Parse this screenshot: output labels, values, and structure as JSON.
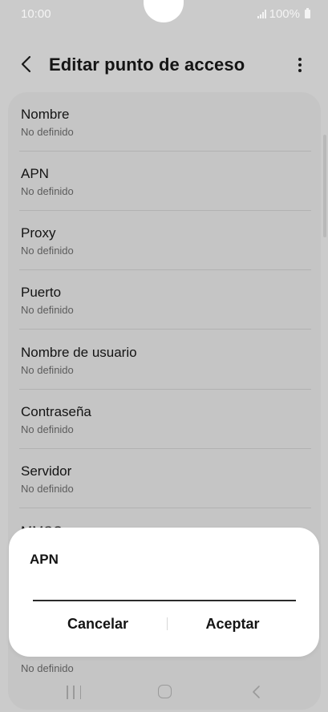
{
  "status_bar": {
    "time": "10:00",
    "battery": "100%"
  },
  "header": {
    "title": "Editar punto de acceso"
  },
  "list": {
    "items": [
      {
        "title": "Nombre",
        "value": "No definido"
      },
      {
        "title": "APN",
        "value": "No definido"
      },
      {
        "title": "Proxy",
        "value": "No definido"
      },
      {
        "title": "Puerto",
        "value": "No definido"
      },
      {
        "title": "Nombre de usuario",
        "value": "No definido"
      },
      {
        "title": "Contraseña",
        "value": "No definido"
      },
      {
        "title": "Servidor",
        "value": "No definido"
      },
      {
        "title": "MMSC",
        "value": "No definido"
      }
    ]
  },
  "dialog": {
    "title": "APN",
    "input_value": "",
    "cancel_label": "Cancelar",
    "accept_label": "Aceptar"
  },
  "colors": {
    "dim_background": "#cbcbcb",
    "card_background": "#c5c5c5",
    "dialog_background": "#ffffff",
    "text_primary": "#141414",
    "text_secondary": "#5c5c5c"
  },
  "icons": {
    "back": "back-arrow-icon",
    "more": "more-vertical-icon",
    "signal": "signal-icon",
    "battery": "battery-icon",
    "nav_recent": "recent-apps-icon",
    "nav_home": "home-icon",
    "nav_back": "nav-back-icon"
  }
}
